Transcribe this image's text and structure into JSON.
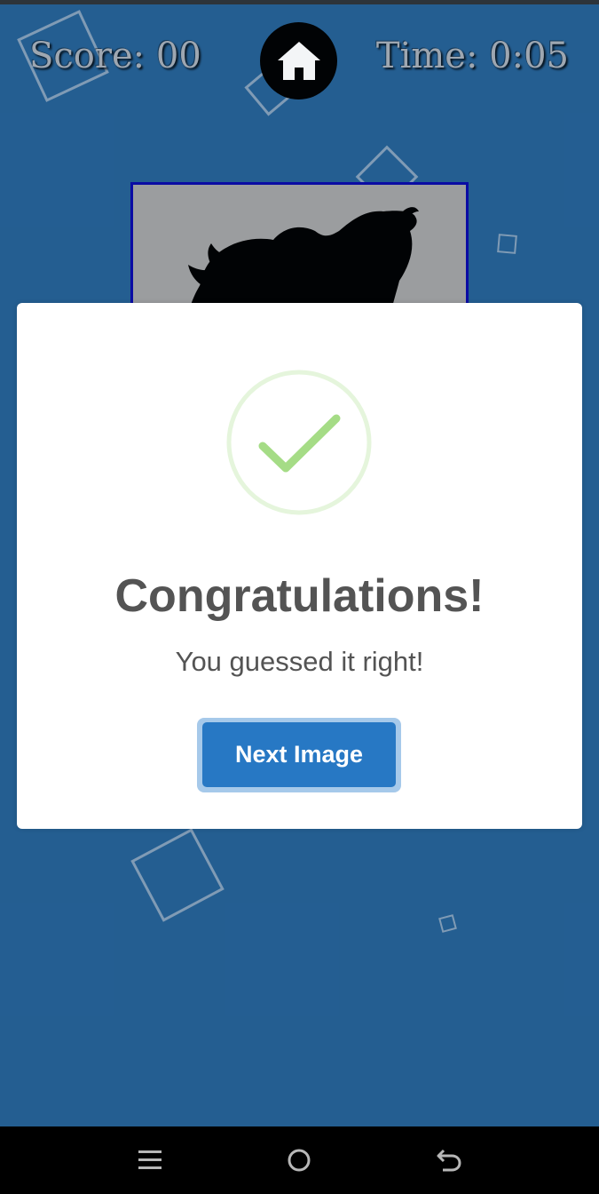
{
  "hud": {
    "score_text": "Score: 00",
    "time_text": "Time: 0:05"
  },
  "icons": {
    "home": "home-icon",
    "success": "check-circle-icon",
    "nav_menu": "menu-icon",
    "nav_home": "circle-home-icon",
    "nav_back": "back-arrow-icon"
  },
  "modal": {
    "title": "Congratulations!",
    "message": "You guessed it right!",
    "button_label": "Next Image"
  },
  "colors": {
    "background": "#256094",
    "accent_button": "#2778c4",
    "success_green": "#a5dc86",
    "frame_border": "#0a0aa8"
  }
}
